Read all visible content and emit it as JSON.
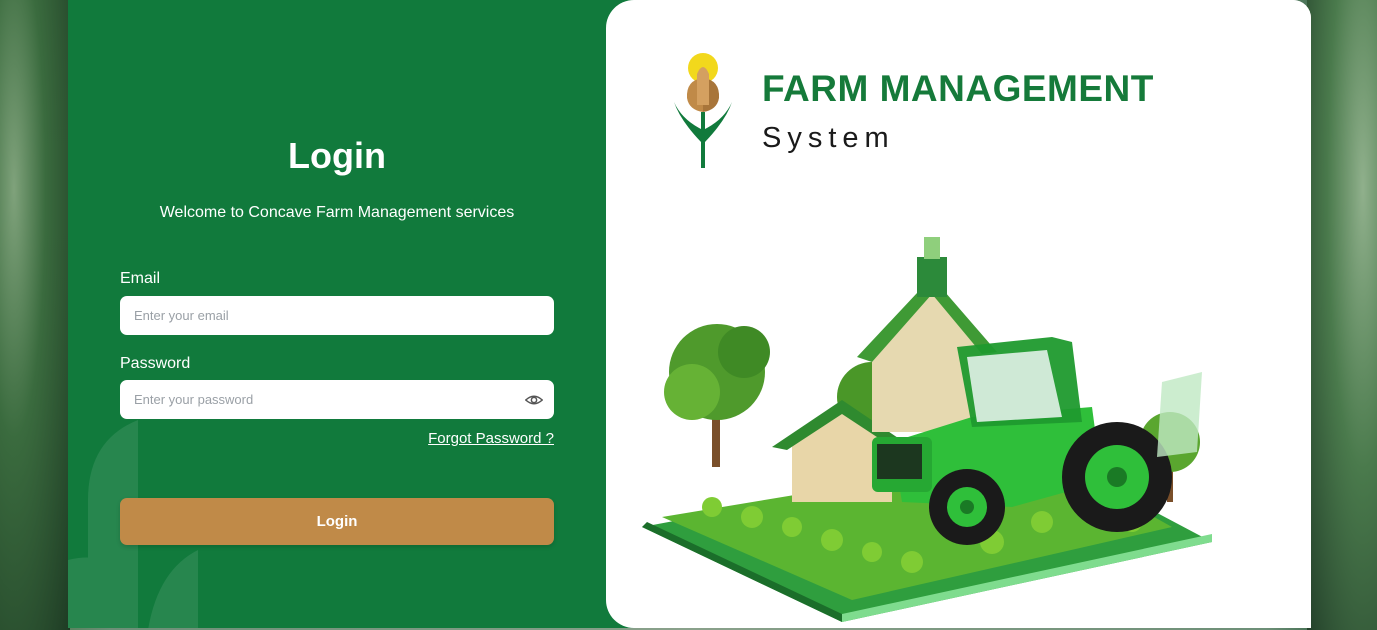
{
  "login": {
    "title": "Login",
    "welcome": "Welcome to Concave Farm Management services",
    "email_label": "Email",
    "email_placeholder": "Enter your email",
    "password_label": "Password",
    "password_placeholder": "Enter your password",
    "forgot_label": "Forgot Password ?",
    "button_label": "Login"
  },
  "brand": {
    "title": "FARM MANAGEMENT",
    "subtitle": "System"
  },
  "colors": {
    "primary_green": "#117a3c",
    "button": "#c08a48",
    "brand_text": "#157a3a"
  },
  "icons": {
    "password_toggle": "eye-icon",
    "logo": "wheat-logo-icon"
  }
}
